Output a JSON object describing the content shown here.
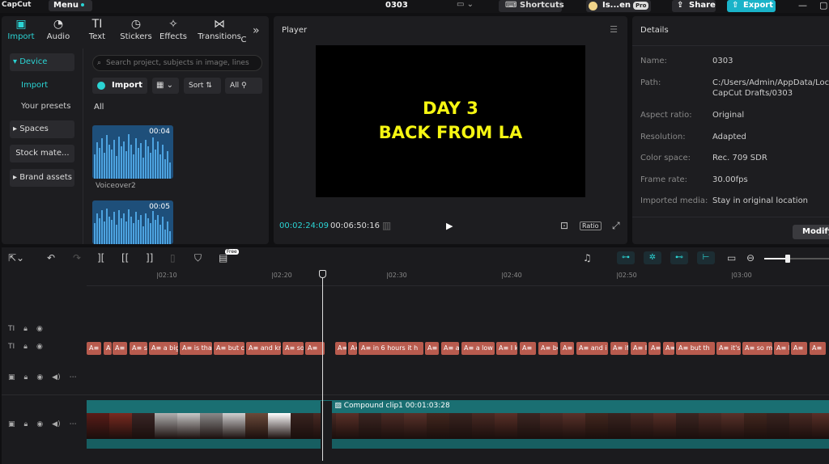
{
  "app": {
    "logo": "CapCut",
    "menu_label": "Menu",
    "project_title": "0303",
    "shortcuts_label": "Shortcuts",
    "user_label": "Is...en",
    "pro_badge": "Pro",
    "share_label": "Share",
    "export_label": "Export"
  },
  "media": {
    "tabs": [
      {
        "label": "Import",
        "icon": "import-icon"
      },
      {
        "label": "Audio",
        "icon": "audio-icon"
      },
      {
        "label": "Text",
        "icon": "text-icon"
      },
      {
        "label": "Stickers",
        "icon": "stickers-icon"
      },
      {
        "label": "Effects",
        "icon": "effects-icon"
      },
      {
        "label": "Transitions",
        "icon": "transitions-icon"
      },
      {
        "label": "C",
        "icon": "more-tab-icon"
      }
    ],
    "sidebar": {
      "device": "Device",
      "import": "Import",
      "presets": "Your presets",
      "spaces": "Spaces",
      "stock": "Stock mate...",
      "brand": "Brand assets"
    },
    "search_placeholder": "Search project, subjects in image, lines",
    "import_button": "Import",
    "sort_label": "Sort",
    "all_filter": "All",
    "all_label": "All",
    "items": [
      {
        "duration": "00:04",
        "name": "Voiceover2"
      },
      {
        "duration": "00:05",
        "name": ""
      }
    ]
  },
  "player": {
    "title": "Player",
    "overlay_line1": "DAY 3",
    "overlay_line2": "BACK FROM LA",
    "current_time": "00:02:24:09",
    "total_time": "00:06:50:16",
    "ratio_label": "Ratio"
  },
  "details": {
    "title": "Details",
    "rows": [
      {
        "label": "Name:",
        "value": "0303"
      },
      {
        "label": "Path:",
        "value": "C:/Users/Admin/AppData/Local/",
        "value2": "CapCut Drafts/0303"
      },
      {
        "label": "Aspect ratio:",
        "value": "Original"
      },
      {
        "label": "Resolution:",
        "value": "Adapted"
      },
      {
        "label": "Color space:",
        "value": "Rec. 709 SDR"
      },
      {
        "label": "Frame rate:",
        "value": "30.00fps"
      },
      {
        "label": "Imported media:",
        "value": "Stay in original location"
      }
    ],
    "modify_button": "Modify"
  },
  "timeline": {
    "free_badge": "Free",
    "ruler": [
      "|02:10",
      "|02:20",
      "|02:30",
      "|02:40",
      "|02:50",
      "|03:00"
    ],
    "subtitles": [
      "A≡",
      "A",
      "A≡ i",
      "A≡ st",
      "A≡ a big",
      "A≡ is tha",
      "A≡ but c",
      "A≡ and kn",
      "A≡ so",
      "A≡",
      "A≡",
      "A≡",
      "A≡ in 6 hours it h",
      "A≡",
      "A≡ a",
      "A≡ a low",
      "A≡ I kno",
      "A≡",
      "A≡ be",
      "A≡",
      "A≡ and i",
      "A≡ if",
      "A≡ I",
      "A≡",
      "A≡",
      "A≡ but th",
      "A≡ it's",
      "A≡ so m",
      "A≡ I c",
      "A≡",
      "A≡"
    ],
    "compound_clip_label": "Compound clip1",
    "compound_clip_duration": "00:01:03:28"
  }
}
